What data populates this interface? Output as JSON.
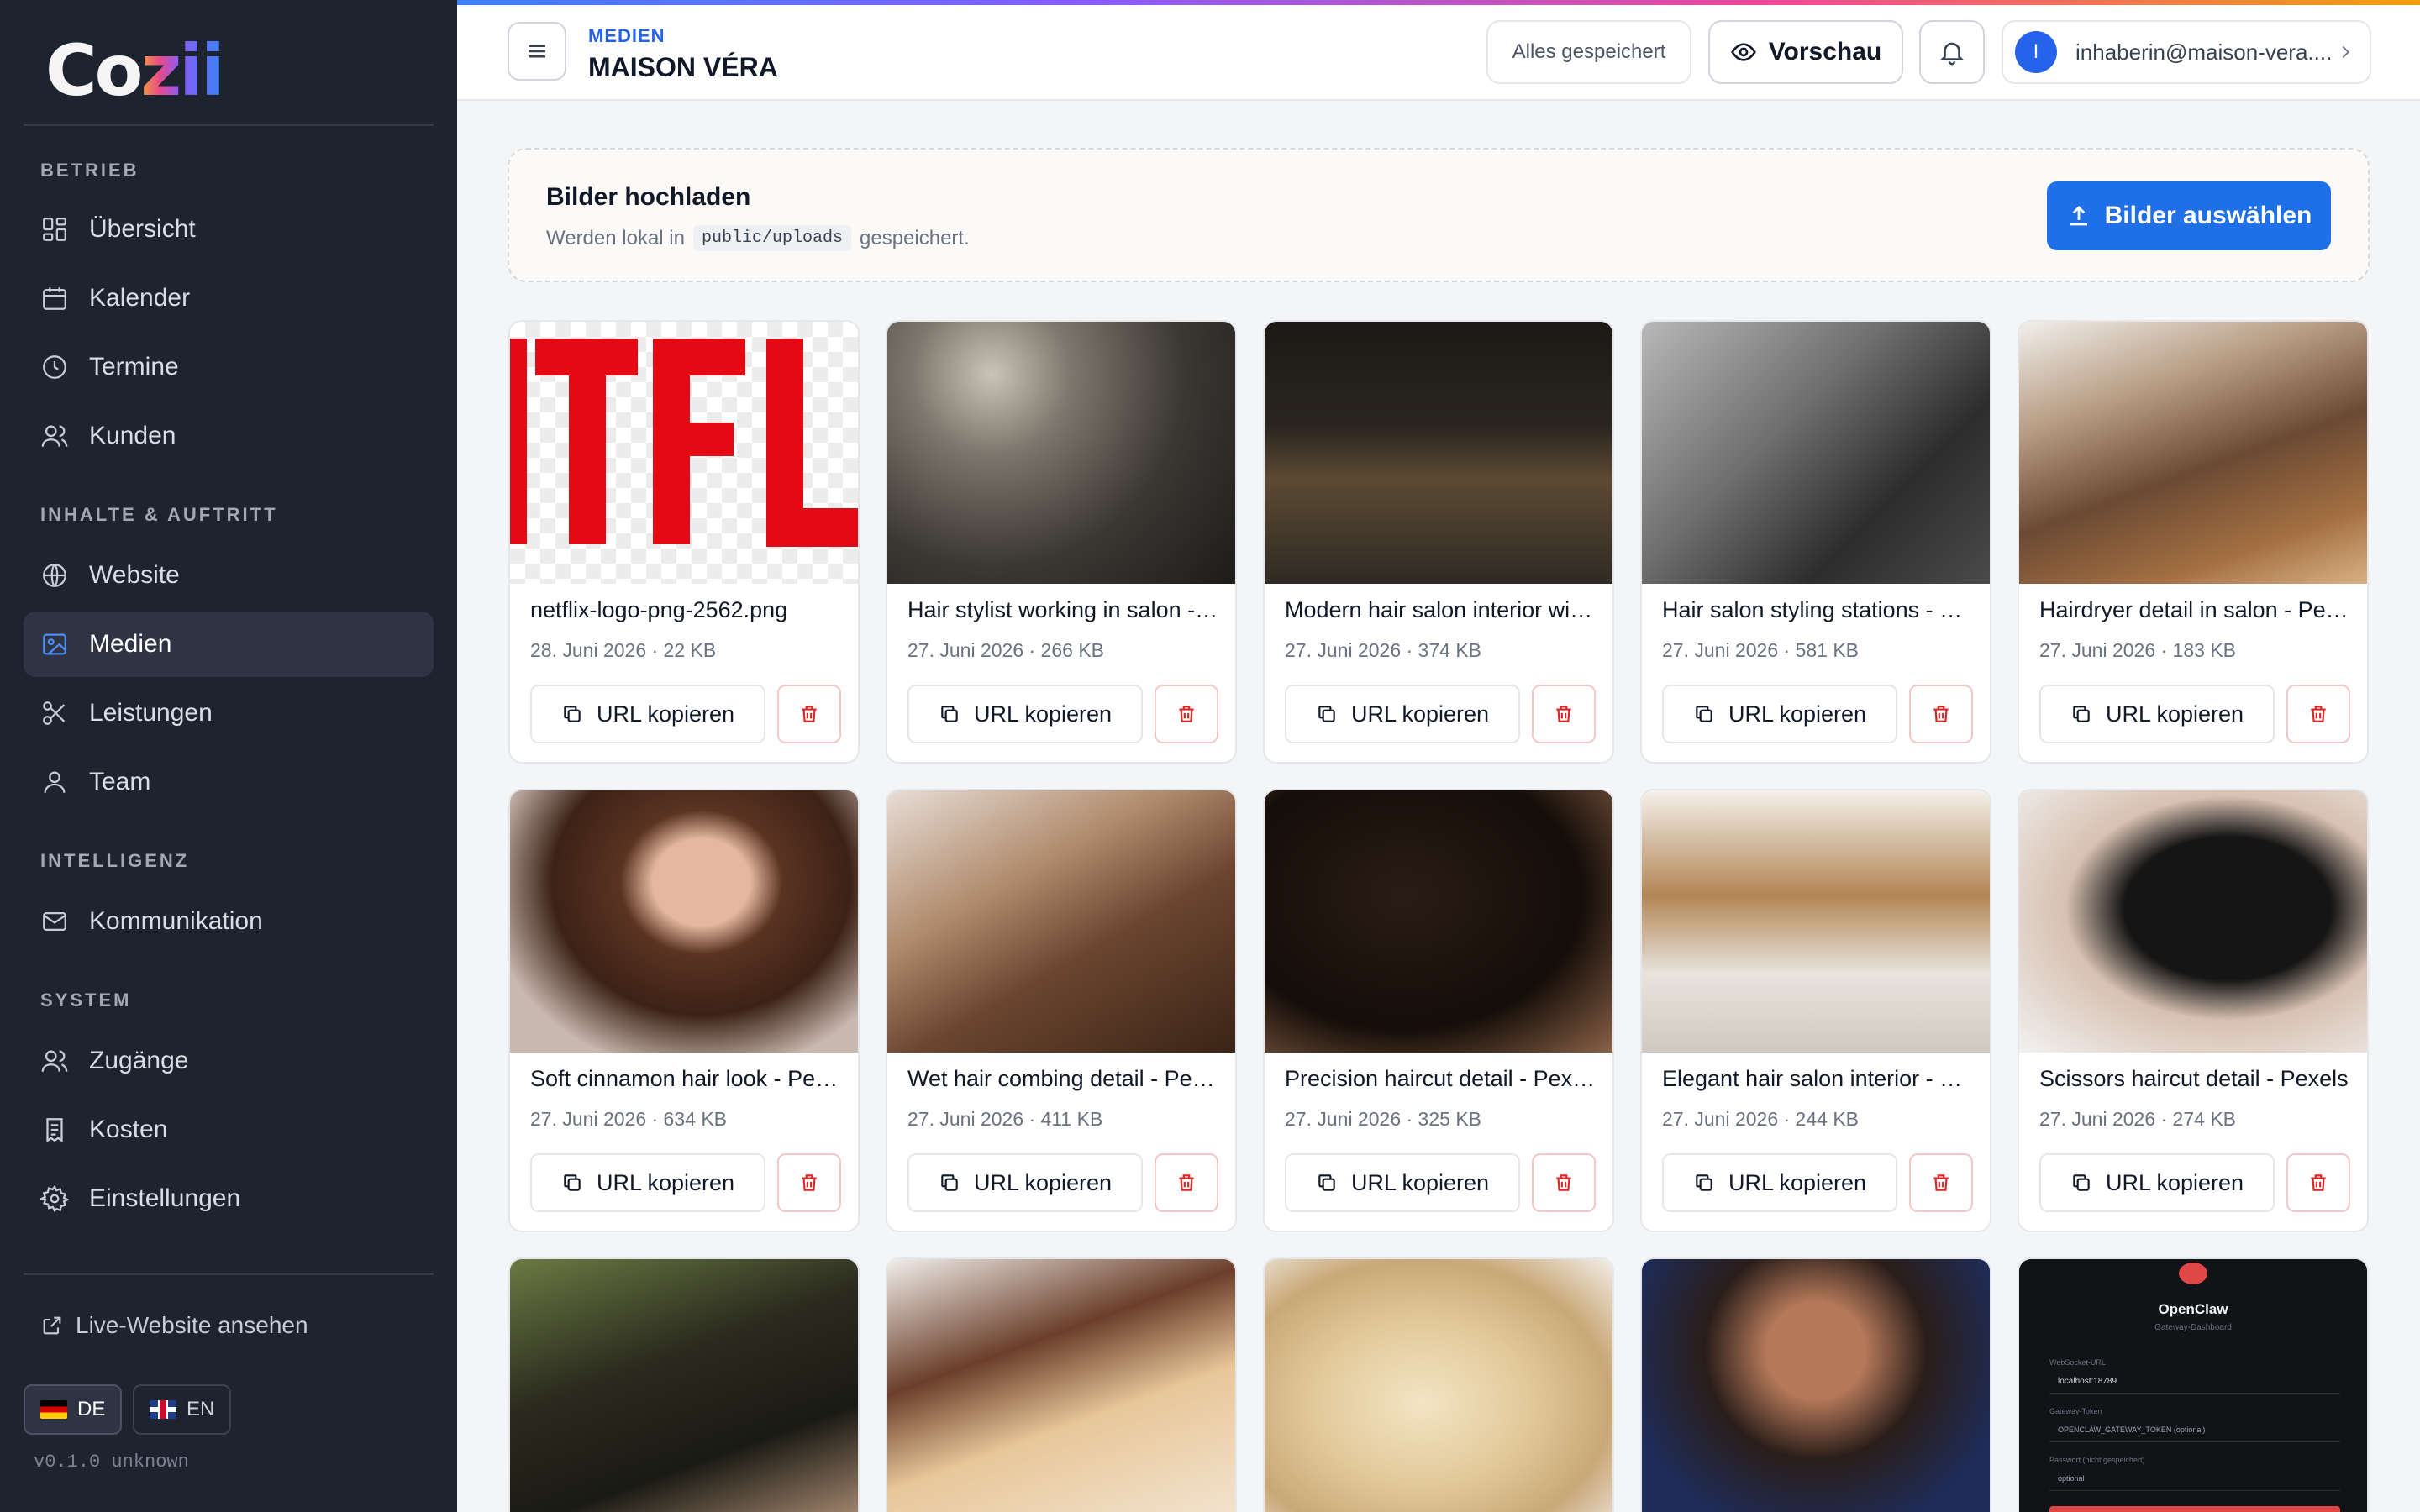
{
  "brand": {
    "name": "Cozii"
  },
  "sidebar": {
    "sections": [
      {
        "title": "BETRIEB",
        "items": [
          {
            "label": "Übersicht",
            "icon": "dashboard-icon"
          },
          {
            "label": "Kalender",
            "icon": "calendar-icon"
          },
          {
            "label": "Termine",
            "icon": "clock-icon"
          },
          {
            "label": "Kunden",
            "icon": "users-icon"
          }
        ]
      },
      {
        "title": "INHALTE & AUFTRITT",
        "items": [
          {
            "label": "Website",
            "icon": "globe-icon"
          },
          {
            "label": "Medien",
            "icon": "image-icon",
            "active": true
          },
          {
            "label": "Leistungen",
            "icon": "scissors-icon"
          },
          {
            "label": "Team",
            "icon": "user-icon"
          }
        ]
      },
      {
        "title": "INTELLIGENZ",
        "items": [
          {
            "label": "Kommunikation",
            "icon": "mail-icon"
          }
        ]
      },
      {
        "title": "SYSTEM",
        "items": [
          {
            "label": "Zugänge",
            "icon": "users-icon"
          },
          {
            "label": "Kosten",
            "icon": "receipt-icon"
          },
          {
            "label": "Einstellungen",
            "icon": "gear-icon"
          }
        ]
      }
    ],
    "live_link": "Live-Website ansehen",
    "languages": [
      {
        "code": "DE",
        "active": true
      },
      {
        "code": "EN",
        "active": false
      }
    ],
    "version": "v0.1.0 unknown"
  },
  "topbar": {
    "breadcrumb": "MEDIEN",
    "title": "MAISON VÉRA",
    "saved_status": "Alles gespeichert",
    "preview_label": "Vorschau",
    "user_initial": "I",
    "user_email": "inhaberin@maison-vera...."
  },
  "upload": {
    "title": "Bilder hochladen",
    "subtitle_prefix": "Werden lokal in",
    "path": "public/uploads",
    "subtitle_suffix": "gespeichert.",
    "button_label": "Bilder auswählen"
  },
  "media": {
    "copy_label": "URL kopieren",
    "items": [
      {
        "name": "netflix-logo-png-2562.png",
        "meta": "28. Juni 2026 · 22 KB"
      },
      {
        "name": "Hair stylist working in salon - Pexels",
        "meta": "27. Juni 2026 · 266 KB"
      },
      {
        "name": "Modern hair salon interior with shelves",
        "meta": "27. Juni 2026 · 374 KB"
      },
      {
        "name": "Hair salon styling stations - Pexels",
        "meta": "27. Juni 2026 · 581 KB"
      },
      {
        "name": "Hairdryer detail in salon - Pexels",
        "meta": "27. Juni 2026 · 183 KB"
      },
      {
        "name": "Soft cinnamon hair look - Pexels",
        "meta": "27. Juni 2026 · 634 KB"
      },
      {
        "name": "Wet hair combing detail - Pexels",
        "meta": "27. Juni 2026 · 411 KB"
      },
      {
        "name": "Precision haircut detail - Pexels",
        "meta": "27. Juni 2026 · 325 KB"
      },
      {
        "name": "Elegant hair salon interior - Pexels",
        "meta": "27. Juni 2026 · 244 KB"
      },
      {
        "name": "Scissors haircut detail - Pexels",
        "meta": "27. Juni 2026 · 274 KB"
      },
      {
        "name": "",
        "meta": ""
      },
      {
        "name": "",
        "meta": ""
      },
      {
        "name": "",
        "meta": ""
      },
      {
        "name": "",
        "meta": ""
      },
      {
        "name": "",
        "meta": ""
      }
    ],
    "openclaw_preview": {
      "title": "OpenClaw",
      "subtitle": "Gateway-Dashboard",
      "ws_label": "WebSocket-URL",
      "ws_value": "localhost:18789",
      "token_label": "Gateway-Token",
      "token_value": "OPENCLAW_GATEWAY_TOKEN (optional)",
      "password_label": "Passwort (nicht gespeichert)",
      "password_value": "optional"
    }
  },
  "colors": {
    "accent": "#1f6fe6",
    "sidebar_bg": "#1e2330",
    "danger": "#dc2626"
  }
}
